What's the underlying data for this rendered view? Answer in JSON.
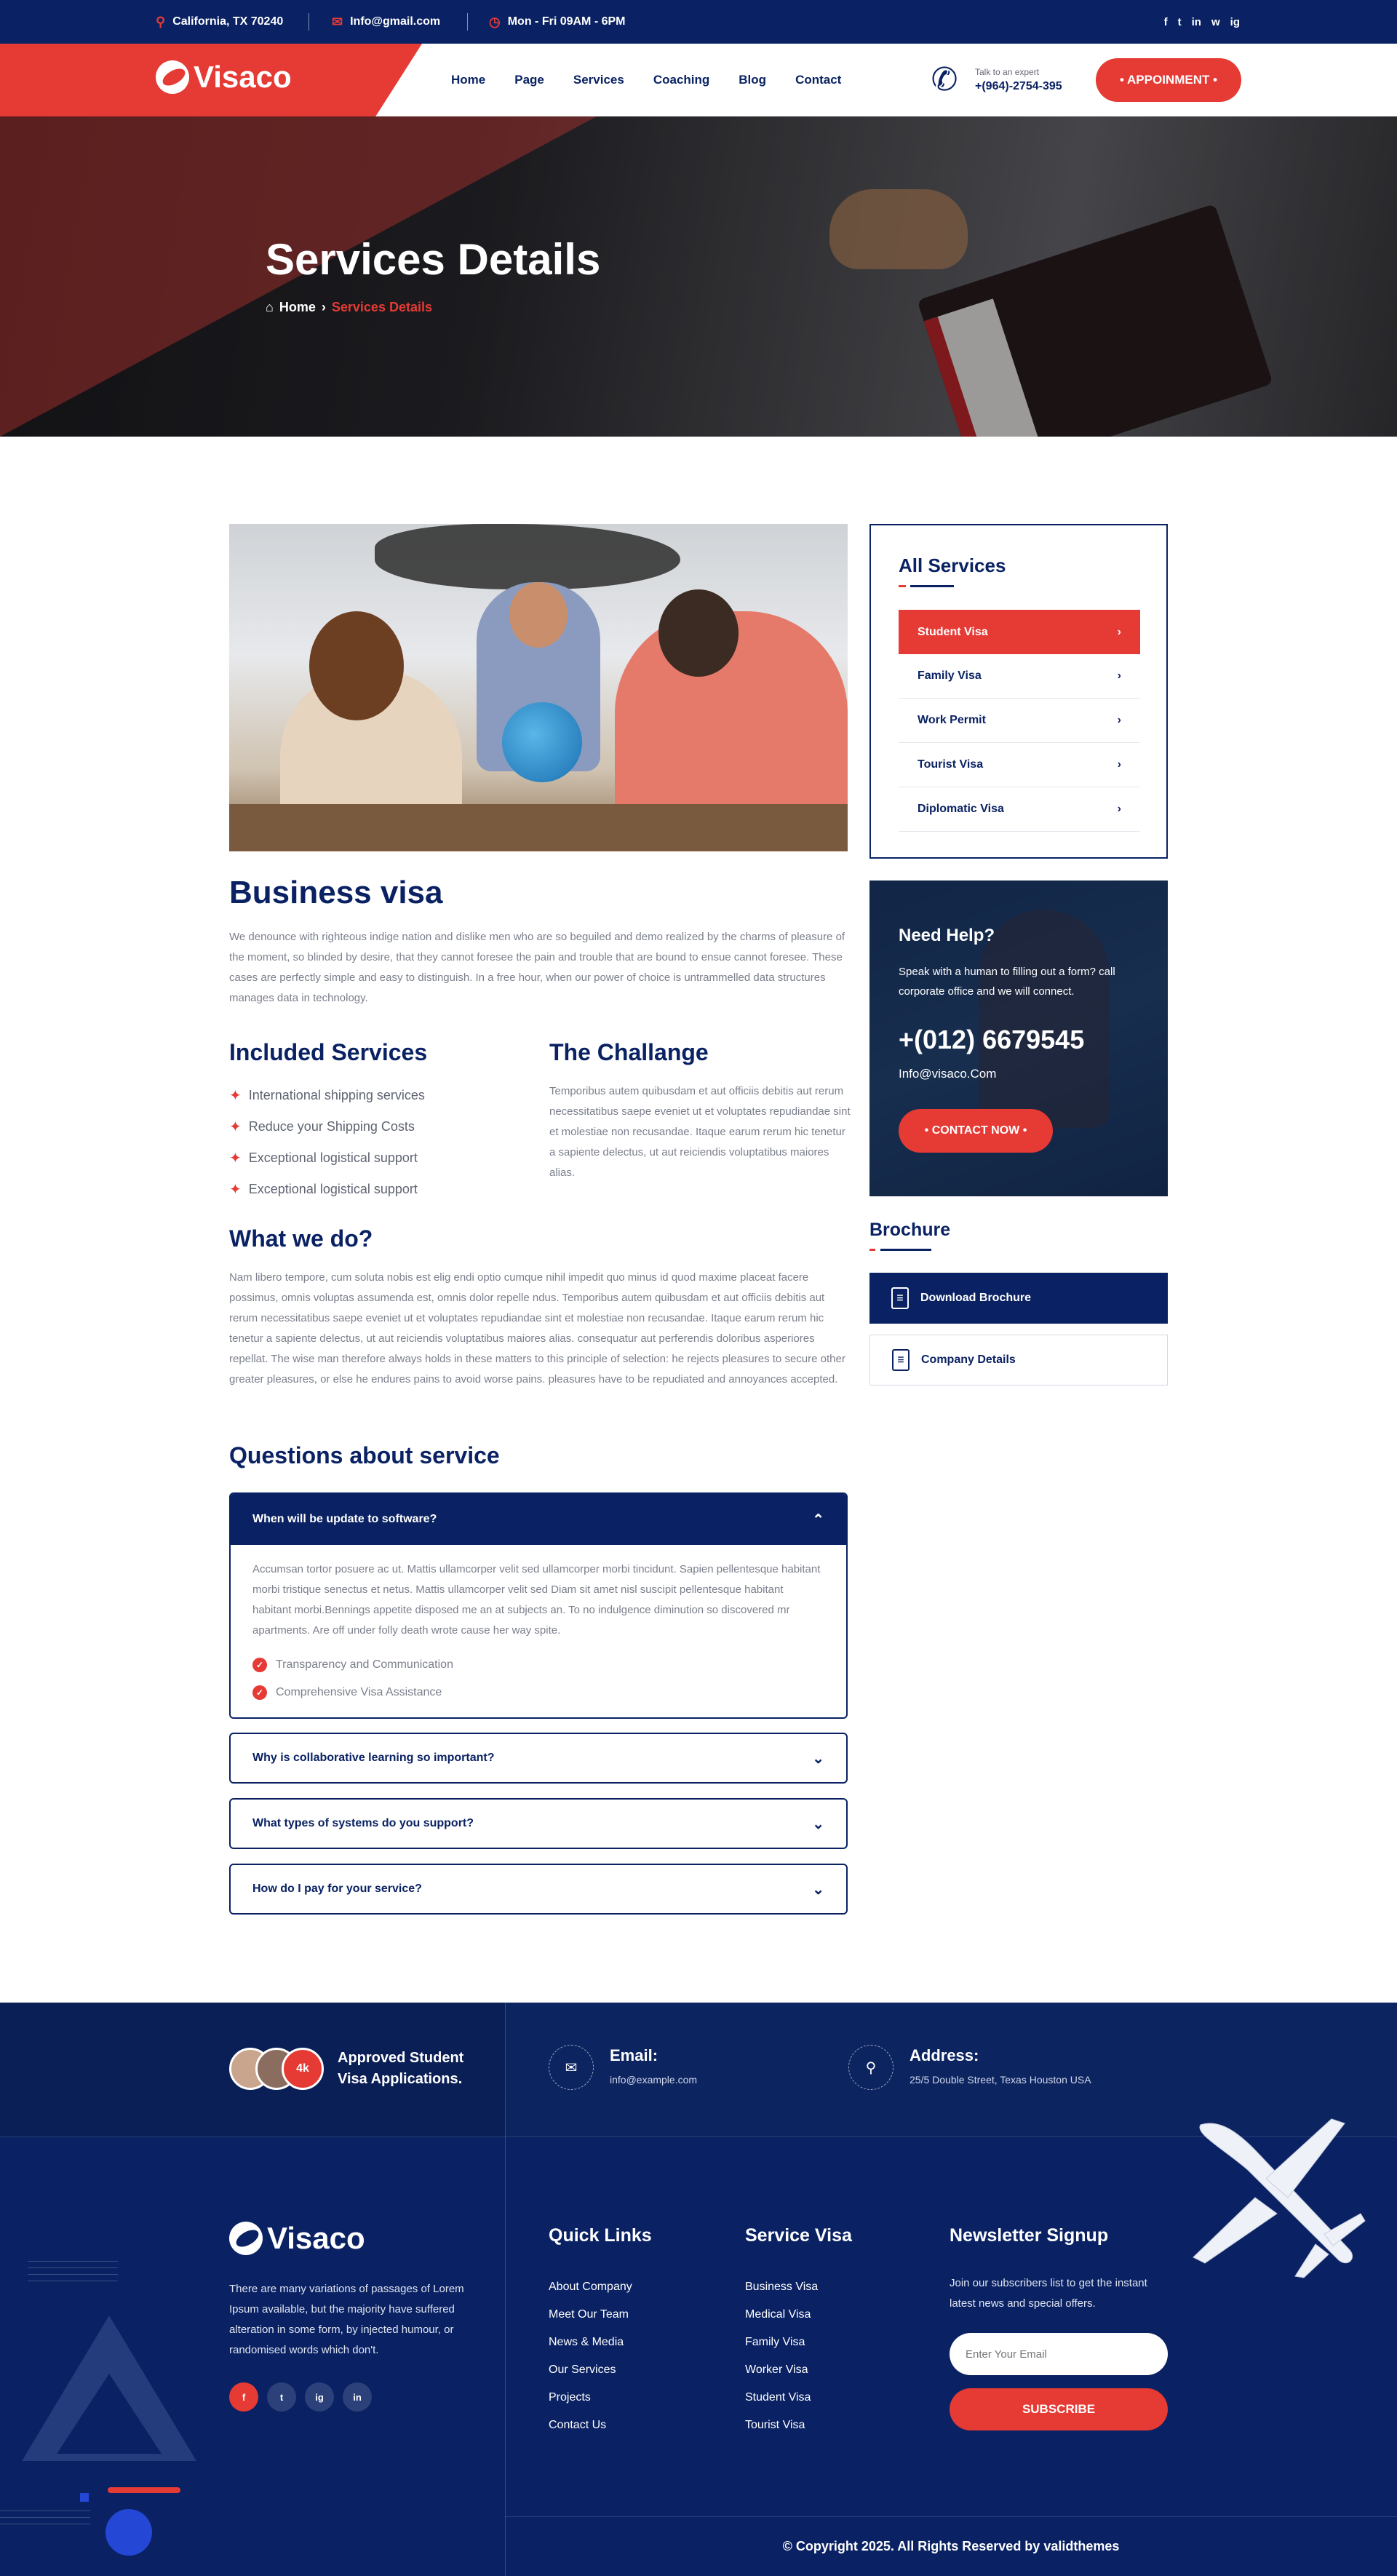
{
  "topbar": {
    "location": "California, TX 70240",
    "email": "Info@gmail.com",
    "hours": "Mon - Fri  09AM - 6PM",
    "social": [
      "f",
      "t",
      "in",
      "w",
      "ig"
    ]
  },
  "header": {
    "logo": "Visaco",
    "nav": [
      "Home",
      "Page",
      "Services",
      "Coaching",
      "Blog",
      "Contact"
    ],
    "expert_label": "Talk to an expert",
    "expert_phone": "+(964)-2754-395",
    "appointment": "• APPOINMENT •"
  },
  "hero": {
    "title": "Services Details",
    "crumb_home": "Home",
    "crumb_sep": "›",
    "crumb_current": "Services Details"
  },
  "main": {
    "title": "Business visa",
    "intro": "We denounce with righteous indige nation and dislike men who are so beguiled and demo realized by the charms of pleasure of the moment, so blinded by desire, that they cannot foresee the pain and trouble that are bound to ensue cannot foresee. These cases are perfectly simple and easy to distinguish. In a free hour, when our power of choice is untrammelled data structures manages data in technology.",
    "included_title": "Included Services",
    "included": [
      "International shipping services",
      "Reduce your Shipping Costs",
      "Exceptional logistical support",
      "Exceptional logistical support"
    ],
    "challenge_title": "The Challange",
    "challenge_text": "Temporibus autem quibusdam et aut officiis debitis aut rerum necessitatibus saepe eveniet ut et voluptates repudiandae sint et molestiae non recusandae. Itaque earum rerum hic tenetur a sapiente delectus, ut aut reiciendis voluptatibus maiores alias.",
    "what_title": "What we do?",
    "what_text": "Nam libero tempore, cum soluta nobis est elig endi optio cumque nihil impedit quo minus id quod maxime placeat facere possimus, omnis voluptas assumenda est, omnis dolor repelle ndus. Temporibus autem quibusdam et aut officiis debitis aut rerum necessitatibus saepe eveniet ut et voluptates repudiandae sint et molestiae non recusandae. Itaque earum rerum hic tenetur a sapiente delectus, ut aut reiciendis voluptatibus maiores alias. consequatur aut perferendis doloribus asperiores repellat. The wise man therefore always holds in these matters to this principle of selection: he rejects pleasures to secure other greater pleasures, or else he endures pains to avoid worse pains. pleasures have to be repudiated and annoyances accepted.",
    "questions_title": "Questions about service",
    "faq_open_q": "When will be update to software?",
    "faq_open_a": "Accumsan tortor posuere ac ut. Mattis ullamcorper velit sed ullamcorper morbi tincidunt. Sapien pellentesque habitant morbi tristique senectus et netus. Mattis ullamcorper velit sed Diam sit amet nisl suscipit pellentesque habitant habitant morbi.Bennings appetite disposed me an at subjects an. To no indulgence diminution so discovered mr apartments. Are off under folly death wrote cause her way spite.",
    "faq_checks": [
      "Transparency and Communication",
      "Comprehensive Visa Assistance"
    ],
    "faq_q2": "Why is collaborative learning so important?",
    "faq_q3": "What types of systems do you support?",
    "faq_q4": "How do I pay for your service?"
  },
  "sidebar": {
    "services_title": "All Services",
    "services": [
      "Student Visa",
      "Family Visa",
      "Work Permit",
      "Tourist Visa",
      "Diplomatic Visa"
    ],
    "help_title": "Need Help?",
    "help_text": "Speak with a human to filling out a form? call corporate office and we will connect.",
    "help_phone": "+(012) 6679545",
    "help_email": "Info@visaco.Com",
    "help_button": "• CONTACT NOW •",
    "brochure_title": "Brochure",
    "brochure_download": "Download Brochure",
    "brochure_company": "Company Details"
  },
  "footer": {
    "avatar_count": "4k",
    "approved": "Approved Student Visa Applications.",
    "email_label": "Email:",
    "email_value": "info@example.com",
    "address_label": "Address:",
    "address_value": "25/5 Double Street, Texas Houston USA",
    "logo": "Visaco",
    "description": "There are many variations of passages of Lorem Ipsum available, but the majority have suffered alteration in some form, by injected humour, or randomised words which don't.",
    "social": [
      "f",
      "t",
      "ig",
      "in"
    ],
    "quick_title": "Quick Links",
    "quick_links": [
      "About Company",
      "Meet Our Team",
      "News & Media",
      "Our Services",
      "Projects",
      "Contact Us"
    ],
    "visa_title": "Service Visa",
    "visa_links": [
      "Business Visa",
      "Medical Visa",
      "Family Visa",
      "Worker Visa",
      "Student Visa",
      "Tourist Visa"
    ],
    "news_title": "Newsletter Signup",
    "news_text": "Join our subscribers list to get the instant latest news and special offers.",
    "news_placeholder": "Enter Your Email",
    "news_button": "SUBSCRIBE",
    "copyright": "© Copyright 2025. All Rights Reserved by validthemes"
  },
  "colors": {
    "navy": "#0a2263",
    "red": "#e63a34"
  }
}
